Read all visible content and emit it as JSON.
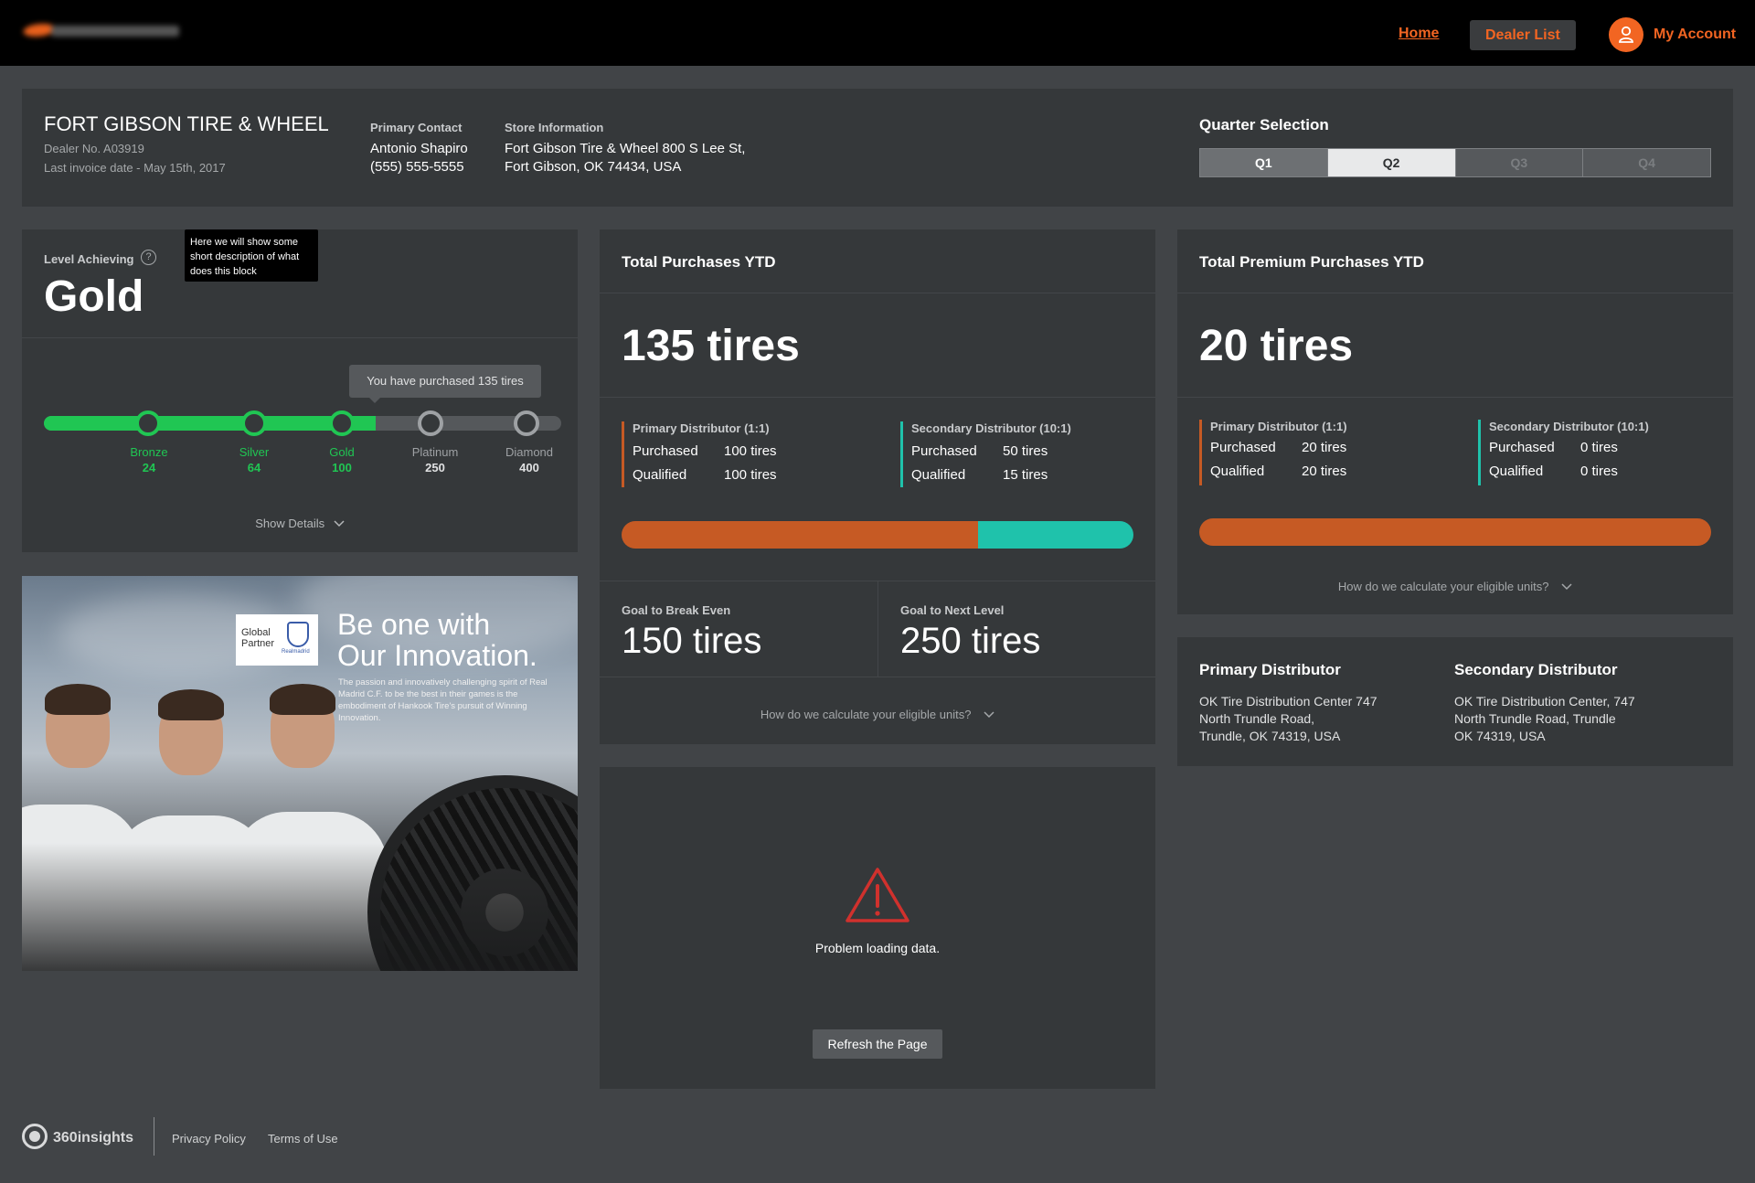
{
  "header": {
    "nav_home": "Home",
    "nav_dealer_list": "Dealer List",
    "account_label": "My Account",
    "account_icon": "user-icon",
    "brand_color": "#f26522"
  },
  "dealer": {
    "name": "FORT GIBSON TIRE & WHEEL",
    "dealer_no": "Dealer No. A03919",
    "last_invoice": "Last invoice date - May 15th, 2017",
    "primary_contact_label": "Primary Contact",
    "primary_contact_name": "Antonio Shapiro",
    "primary_contact_phone": "(555) 555-5555",
    "store_info_label": "Store Information",
    "store_line1": "Fort Gibson Tire & Wheel 800 S Lee St,",
    "store_line2": "Fort Gibson, OK 74434, USA"
  },
  "quarter_selection": {
    "title": "Quarter Selection",
    "quarters": [
      {
        "label": "Q1",
        "state": "normal"
      },
      {
        "label": "Q2",
        "state": "active"
      },
      {
        "label": "Q3",
        "state": "disabled"
      },
      {
        "label": "Q4",
        "state": "disabled"
      }
    ]
  },
  "level": {
    "label": "Level Achieving",
    "help_icon": "question-circle-icon",
    "tooltip": "Here we will show some short description of what does this block",
    "value": "Gold",
    "purchase_tooltip": "You have purchased 135 tires",
    "purchased": 135,
    "max": 400,
    "tiers": [
      {
        "name": "Bronze",
        "threshold": "24",
        "achieved": true
      },
      {
        "name": "Silver",
        "threshold": "64",
        "achieved": true
      },
      {
        "name": "Gold",
        "threshold": "100",
        "achieved": true
      },
      {
        "name": "Platinum",
        "threshold": "250",
        "achieved": false
      },
      {
        "name": "Diamond",
        "threshold": "400",
        "achieved": false
      }
    ],
    "show_details": "Show Details"
  },
  "promo": {
    "badge_line1": "Global",
    "badge_line2": "Partner",
    "badge_club": "Realmadrid",
    "headline_line1": "Be one with",
    "headline_line2": "Our Innovation.",
    "body": "The passion and innovatively challenging spirit of Real Madrid C.F. to be the best in their games is the embodiment of Hankook Tire's pursuit of Winning Innovation."
  },
  "total_purchases": {
    "title": "Total Purchases YTD",
    "value": "135 tires",
    "primary": {
      "label": "Primary Distributor (1:1)",
      "purchased_label": "Purchased",
      "purchased": "100 tires",
      "qualified_label": "Qualified",
      "qualified": "100 tires",
      "color": "#c65a24"
    },
    "secondary": {
      "label": "Secondary Distributor (10:1)",
      "purchased_label": "Purchased",
      "purchased": "50 tires",
      "qualified_label": "Qualified",
      "qualified": "15 tires",
      "color": "#1fc2ab"
    },
    "bar_primary_share": 0.697,
    "goal_break_even_label": "Goal to Break Even",
    "goal_break_even": "150 tires",
    "goal_next_label": "Goal to Next Level",
    "goal_next": "250 tires",
    "calc_link": "How do we calculate your eligible units?"
  },
  "premium_purchases": {
    "title": "Total Premium Purchases YTD",
    "value": "20 tires",
    "primary": {
      "label": "Primary Distributor (1:1)",
      "purchased_label": "Purchased",
      "purchased": "20 tires",
      "qualified_label": "Qualified",
      "qualified": "20 tires"
    },
    "secondary": {
      "label": "Secondary Distributor (10:1)",
      "purchased_label": "Purchased",
      "purchased": "0 tires",
      "qualified_label": "Qualified",
      "qualified": "0 tires"
    },
    "bar_primary_share": 1.0,
    "calc_link": "How do we calculate your eligible units?"
  },
  "error_block": {
    "icon": "warning-triangle-icon",
    "message": "Problem loading data.",
    "button": "Refresh the Page"
  },
  "distributors": {
    "primary_title": "Primary Distributor",
    "primary_line1": "OK Tire Distribution Center 747",
    "primary_line2": "North Trundle Road,",
    "primary_line3": "Trundle, OK 74319, USA",
    "secondary_title": "Secondary Distributor",
    "secondary_line1": "OK Tire Distribution Center, 747",
    "secondary_line2": "North Trundle Road, Trundle",
    "secondary_line3": "OK 74319, USA"
  },
  "footer": {
    "brand": "360insights",
    "privacy": "Privacy Policy",
    "terms": "Terms of Use"
  }
}
